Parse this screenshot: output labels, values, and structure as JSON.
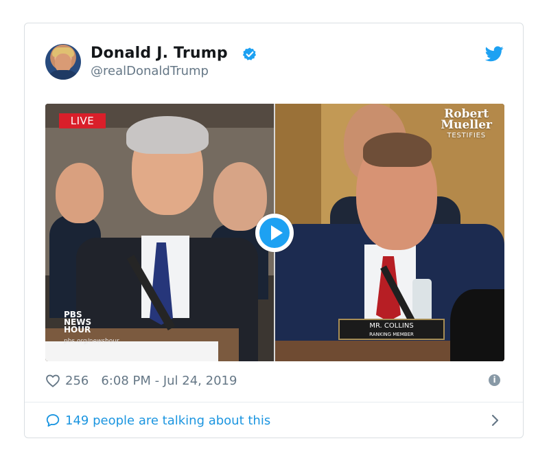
{
  "tweet": {
    "author_name": "Donald J. Trump",
    "handle": "@realDonaldTrump",
    "likes": "256",
    "timestamp": "6:08 PM - Jul 24, 2019",
    "conversation_text": "149 people are talking about this"
  },
  "video": {
    "live_badge": "LIVE",
    "pbs_line1": "PBS",
    "pbs_line2": "NEWS",
    "pbs_line3": "HOUR",
    "pbs_url": "pbs.org/newshour",
    "title_line1": "Robert",
    "title_line2": "Mueller",
    "title_line3": "TESTIFIES",
    "nameplate_line1": "MR. COLLINS",
    "nameplate_line2": "RANKING MEMBER"
  },
  "icons": {
    "brand": "twitter-bird-icon",
    "verified": "verified-badge-icon",
    "like": "heart-icon",
    "info": "info-icon",
    "replies": "reply-bubble-icon",
    "next": "chevron-right-icon",
    "play": "play-icon"
  },
  "colors": {
    "twitter_blue": "#1da1f2",
    "link_blue": "#1b95e0",
    "live_red": "#d91f2a",
    "text_dark": "#14171a",
    "text_muted": "#657786"
  }
}
